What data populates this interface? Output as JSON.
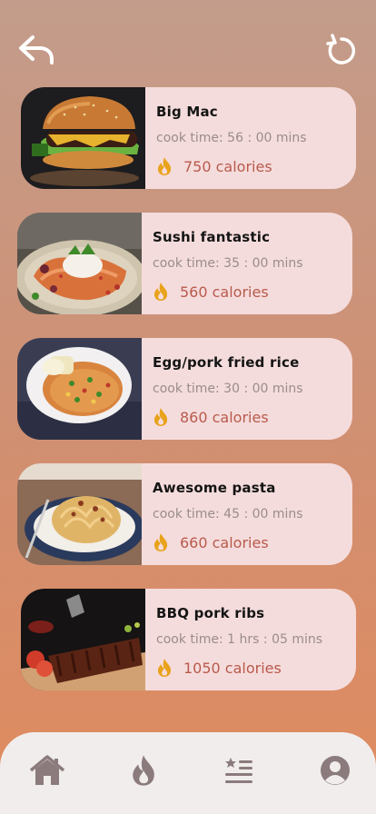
{
  "nav": {
    "back_icon": "undo-arrow-icon",
    "refresh_icon": "refresh-icon"
  },
  "recipes": [
    {
      "title": "Big Mac",
      "cook_time": "cook time: 56 : 00 mins",
      "calories": "750 calories",
      "image": "burger"
    },
    {
      "title": "Sushi fantastic",
      "cook_time": "cook time: 35 : 00 mins",
      "calories": "560 calories",
      "image": "sushi"
    },
    {
      "title": "Egg/pork fried rice",
      "cook_time": "cook time: 30 : 00 mins",
      "calories": "860 calories",
      "image": "fried-rice"
    },
    {
      "title": "Awesome pasta",
      "cook_time": "cook time: 45 : 00 mins",
      "calories": "660 calories",
      "image": "pasta"
    },
    {
      "title": "BBQ pork ribs",
      "cook_time": "cook time: 1 hrs : 05 mins",
      "calories": "1050 calories",
      "image": "ribs"
    }
  ],
  "bottom_nav": [
    {
      "icon": "home-icon"
    },
    {
      "icon": "flame-icon"
    },
    {
      "icon": "list-icon"
    },
    {
      "icon": "profile-icon"
    }
  ],
  "colors": {
    "card": "#f5dcdc",
    "calorie_text": "#b85a4c",
    "flame": "#e8a21b",
    "nav_icon": "#8b7b7c"
  }
}
